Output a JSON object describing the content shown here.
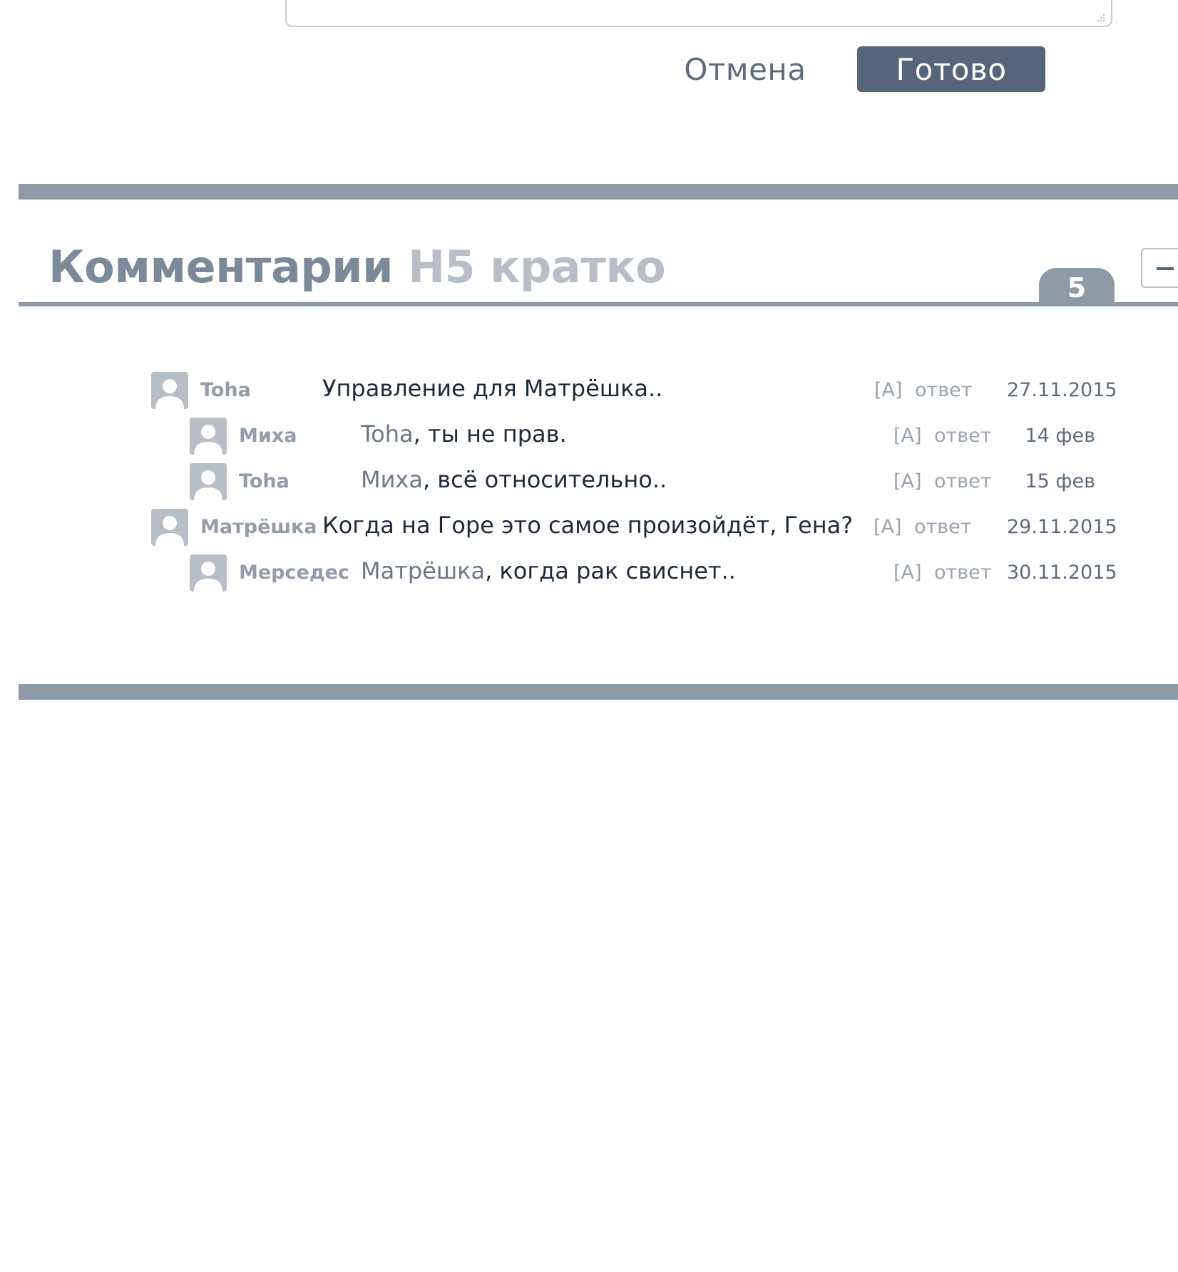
{
  "editor": {
    "cancel_label": "Отмена",
    "done_label": "Готово"
  },
  "comments_section": {
    "title": "Комментарии",
    "subtitle": "H5 кратко",
    "count": "5",
    "collapse_label": "−"
  },
  "comments": [
    {
      "author": "Toha",
      "mention": "",
      "text": "Управление для Матрёшка..",
      "admin": "[A]",
      "reply": "ответ",
      "date": "27.11.2015"
    },
    {
      "author": "Миха",
      "mention": "Toha",
      "text": ", ты не прав.",
      "admin": "[A]",
      "reply": "ответ",
      "date": "14 фев"
    },
    {
      "author": "Toha",
      "mention": "Миха",
      "text": ", всё относительно..",
      "admin": "[A]",
      "reply": "ответ",
      "date": "15 фев"
    },
    {
      "author": "Матрёшка",
      "mention": "",
      "text": "Когда на Горе это самое произойдёт, Гена?",
      "admin": "[A]",
      "reply": "ответ",
      "date": "29.11.2015"
    },
    {
      "author": "Мерседес",
      "mention": "Матрёшка",
      "text": ", когда рак свиснет..",
      "admin": "[A]",
      "reply": "ответ",
      "date": "30.11.2015"
    }
  ],
  "colors": {
    "accent_dark": "#56657a",
    "bar_gray": "#8e9aa6",
    "muted_text": "#939ca8",
    "light_text": "#b8bec6"
  },
  "icons": {
    "avatar": "user-silhouette-icon",
    "resize": "resize-grip-icon",
    "collapse": "minus-icon"
  }
}
